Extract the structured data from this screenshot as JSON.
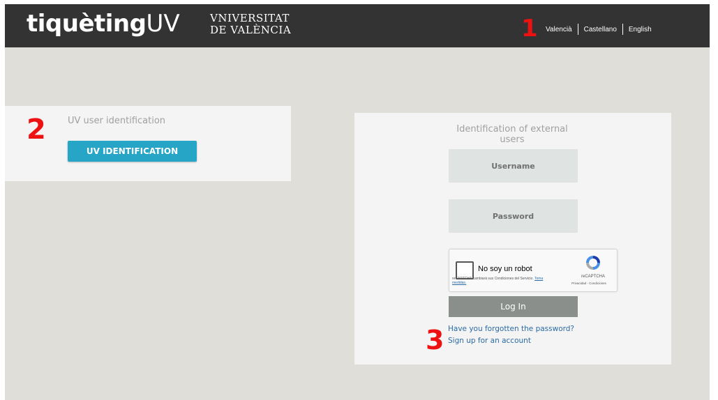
{
  "header": {
    "brand_main": "tiquèting",
    "brand_suffix": "UV",
    "university_line1": "VNIVERSITAT",
    "university_line2": "DE VALÈNCIA",
    "languages": [
      "Valencià",
      "Castellano",
      "English"
    ],
    "bg_color": "#333333"
  },
  "markers": [
    "1",
    "2",
    "3"
  ],
  "uv_login": {
    "title": "UV user identification",
    "button_label": "UV IDENTIFICATION",
    "button_color": "#27a5c6"
  },
  "external_login": {
    "title": "Identification of external users",
    "username_placeholder": "Username",
    "password_placeholder": "Password",
    "captcha": {
      "label": "No soy un robot",
      "terms_text": "reCAPTCHA cambiará sus Condiciones del Servicio.",
      "terms_link": "Toma medidas.",
      "brand": "reCAPTCHA",
      "privacy": "Privacidad",
      "conditions": "Condiciones"
    },
    "login_button": "Log In",
    "forgot_link": "Have you forgotten the password?",
    "signup_link": "Sign up for an account"
  },
  "colors": {
    "page_bg": "#e0ded8",
    "panel_bg": "#f4f4f4",
    "link": "#2a6aa6",
    "marker": "#ee1111"
  }
}
